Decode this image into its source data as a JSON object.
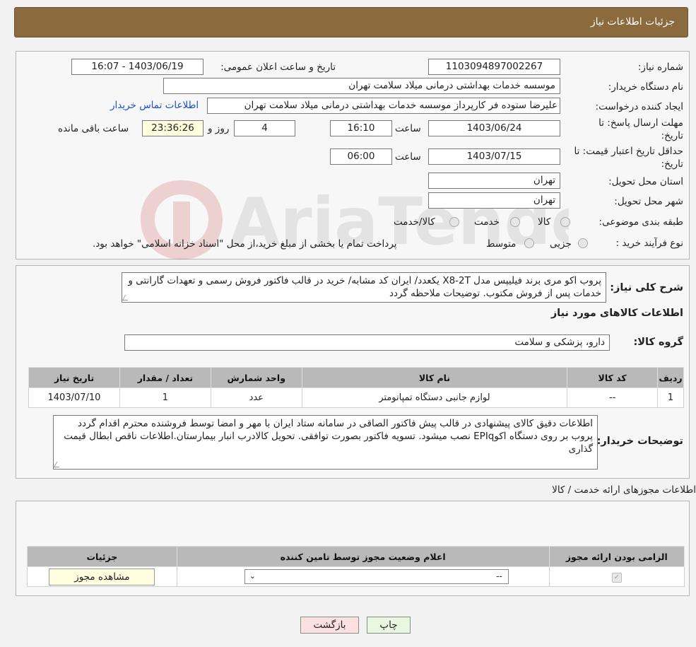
{
  "header": {
    "title": "جزئیات اطلاعات نیاز"
  },
  "form": {
    "need_number_label": "شماره نیاز:",
    "need_number": "1103094897002267",
    "announce_label": "تاریخ و ساعت اعلان عمومی:",
    "announce_value": "1403/06/19 - 16:07",
    "buyer_org_label": "نام دستگاه خریدار:",
    "buyer_org": "موسسه خدمات بهداشتی درمانی میلاد سلامت تهران",
    "creator_label": "ایجاد کننده درخواست:",
    "creator": "علیرضا ستوده فر کارپرداز موسسه خدمات بهداشتی درمانی میلاد سلامت تهران",
    "contact_link": "اطلاعات تماس خریدار",
    "deadline_label": "مهلت ارسال پاسخ: تا",
    "deadline_label2": "تاریخ:",
    "deadline_date": "1403/06/24",
    "time_label": "ساعت",
    "deadline_time": "16:10",
    "days": "4",
    "days_label": "روز و",
    "remaining_time": "23:36:26",
    "remaining_label": "ساعت باقی مانده",
    "validity_label": "حداقل تاریخ اعتبار قیمت: تا",
    "validity_label2": "تاریخ:",
    "validity_date": "1403/07/15",
    "validity_time": "06:00",
    "province_label": "استان محل تحویل:",
    "province": "تهران",
    "city_label": "شهر محل تحویل:",
    "city": "تهران",
    "category_label": "طبقه بندی موضوعی:",
    "category_options": [
      "کالا",
      "خدمت",
      "کالا/خدمت"
    ],
    "process_label": "نوع فرآیند خرید :",
    "process_options": [
      "جزیی",
      "متوسط"
    ],
    "process_note": "پرداخت تمام یا بخشی از مبلغ خرید،از محل \"اسناد خزانه اسلامی\" خواهد بود."
  },
  "summary": {
    "label": "شرح کلی نیاز:",
    "text": "پروب اکو مری برند فیلیپس مدل X8-2T یکعدد/ ایران کد مشابه/ خرید در قالب فاکتور فروش رسمی و تعهدات گارانتی و خدمات پس از فروش مکتوب. توضیحات ملاحظه گردد",
    "goods_title": "اطلاعات کالاهای مورد نیاز",
    "group_label": "گروه کالا:",
    "group_value": "دارو، پزشکی و سلامت"
  },
  "goods_table": {
    "headers": [
      "ردیف",
      "کد کالا",
      "نام کالا",
      "واحد شمارش",
      "تعداد / مقدار",
      "تاریخ نیاز"
    ],
    "rows": [
      [
        "1",
        "--",
        "لوازم جانبی دستگاه تمپانومتر",
        "عدد",
        "1",
        "1403/07/10"
      ]
    ]
  },
  "buyer_notes": {
    "label": "توضیحات خریدار:",
    "text": "اطلاعات دقیق کالای پیشنهادی در قالب پیش فاکتور الصاقی در سامانه ستاد ایران با مهر و امضا توسط فروشنده محترم اقدام گردد پروب بر روی دستگاه اکوEPIq نصب میشود. تسویه فاکتور بصورت توافقی. تحویل کالادرب انبار بیمارستان.اطلاعات ناقص ابطال قیمت گذاری"
  },
  "permits": {
    "title": "اطلاعات مجوزهای ارائه خدمت / کالا",
    "headers": [
      "الزامی بودن ارائه مجوز",
      "اعلام وضعیت مجوز توسط تامین کننده",
      "جزئیات"
    ],
    "select_value": "--",
    "view_button": "مشاهده مجوز"
  },
  "buttons": {
    "print": "چاپ",
    "back": "بازگشت"
  },
  "watermark": {
    "text": "AriaTender.neT"
  },
  "colors": {
    "header": "#8b6a3e",
    "link": "#1a4fd1",
    "yellow": "#ffffe0",
    "back_button": "#fde0e0",
    "print_button": "#e8f7e0"
  }
}
